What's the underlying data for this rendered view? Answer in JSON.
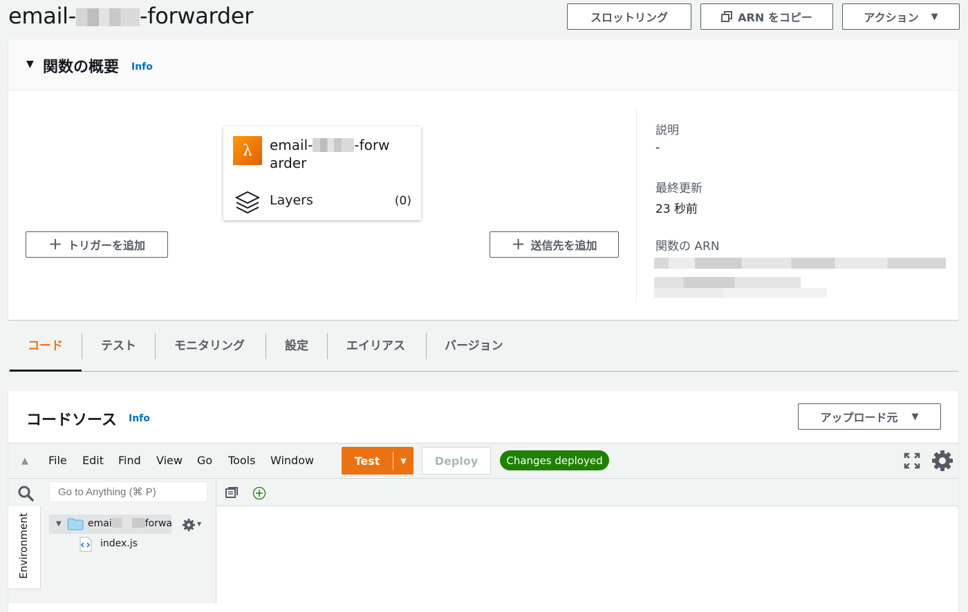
{
  "page": {
    "title_prefix": "email-",
    "title_suffix": "-forwarder",
    "buttons": {
      "throttle": "スロットリング",
      "copy_arn": "ARN をコピー",
      "actions": "アクション"
    }
  },
  "overview": {
    "heading": "関数の概要",
    "info": "Info",
    "function_name_line1_prefix": "email-",
    "function_name_line1_suffix": "-forw",
    "function_name_line2": "arder",
    "layers_label": "Layers",
    "layers_count": "(0)",
    "add_trigger": "トリガーを追加",
    "add_destination": "送信先を追加",
    "description_label": "説明",
    "description_value": "-",
    "last_modified_label": "最終更新",
    "last_modified_value": "23 秒前",
    "arn_label": "関数の ARN"
  },
  "tabs": [
    {
      "label": "コード",
      "active": true
    },
    {
      "label": "テスト"
    },
    {
      "label": "モニタリング"
    },
    {
      "label": "設定"
    },
    {
      "label": "エイリアス"
    },
    {
      "label": "バージョン"
    }
  ],
  "code_source": {
    "heading": "コードソース",
    "info": "Info",
    "upload_from": "アップロード元",
    "menu": [
      "File",
      "Edit",
      "Find",
      "View",
      "Go",
      "Tools",
      "Window"
    ],
    "test_button": "Test",
    "deploy_button": "Deploy",
    "status_badge": "Changes deployed",
    "search_placeholder": "Go to Anything (⌘ P)",
    "environment_label": "Environment",
    "folder_prefix": "emai",
    "folder_suffix": "forwarc",
    "file_name": "index.js"
  },
  "colors": {
    "accent_orange": "#ec7211",
    "status_green": "#1d8102",
    "link_blue": "#0073bb"
  }
}
